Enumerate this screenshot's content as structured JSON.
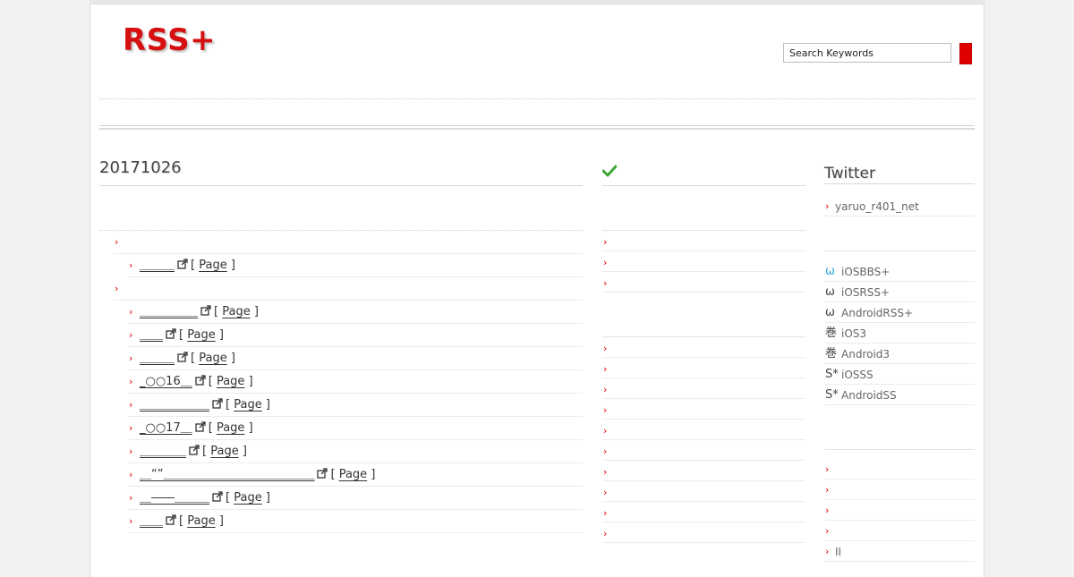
{
  "site": {
    "logo": "RSS+",
    "search_placeholder": "Search Keywords"
  },
  "main": {
    "date_title": "20171026",
    "rows": [
      {
        "type": "category"
      },
      {
        "type": "entry",
        "title": "＿＿＿",
        "page_label": "Page"
      },
      {
        "type": "category"
      },
      {
        "type": "entry",
        "title": "＿＿＿＿＿",
        "page_label": "Page"
      },
      {
        "type": "entry",
        "title": "＿＿",
        "page_label": "Page"
      },
      {
        "type": "entry",
        "title": "＿＿＿",
        "page_label": "Page"
      },
      {
        "type": "entry",
        "title": "_○○16＿",
        "page_label": "Page"
      },
      {
        "type": "entry",
        "title": "＿＿＿＿＿＿",
        "page_label": "Page"
      },
      {
        "type": "entry",
        "title": "_○○17＿",
        "page_label": "Page"
      },
      {
        "type": "entry",
        "title": "＿＿＿＿",
        "page_label": "Page"
      },
      {
        "type": "entry",
        "title": "＿“”＿＿＿＿＿＿＿＿＿＿＿＿＿",
        "page_label": "Page"
      },
      {
        "type": "entry",
        "title": "＿――＿＿＿",
        "page_label": "Page"
      },
      {
        "type": "entry",
        "title": "＿＿",
        "page_label": "Page"
      }
    ]
  },
  "middle": {
    "group1_count": 3,
    "group2_count": 10
  },
  "sidebar": {
    "twitter_title": "Twitter",
    "twitter_account": "yaruo_r401_net",
    "apps": [
      {
        "icon": "omega-blue-icon",
        "glyph": "ω",
        "color": "#2aa6d8",
        "label": "iOSBBS+"
      },
      {
        "icon": "omega-icon",
        "glyph": "ω",
        "color": "#444444",
        "label": "iOSRSS+"
      },
      {
        "icon": "omega-icon",
        "glyph": "ω",
        "color": "#444444",
        "label": "AndroidRSS+"
      },
      {
        "icon": "scroll-kanji-icon",
        "glyph": "巻",
        "color": "#444444",
        "label": "iOS3"
      },
      {
        "icon": "scroll-kanji-icon",
        "glyph": "巻",
        "color": "#444444",
        "label": "Android3"
      },
      {
        "icon": "s-star-icon",
        "glyph": "S*",
        "color": "#444444",
        "label": "iOSSS"
      },
      {
        "icon": "s-star-icon",
        "glyph": "S*",
        "color": "#444444",
        "label": "AndroidSS"
      }
    ],
    "bottom_rows": [
      "",
      "",
      "",
      "",
      "II"
    ]
  },
  "colors": {
    "accent": "#e00000",
    "logo": "#d61010"
  }
}
